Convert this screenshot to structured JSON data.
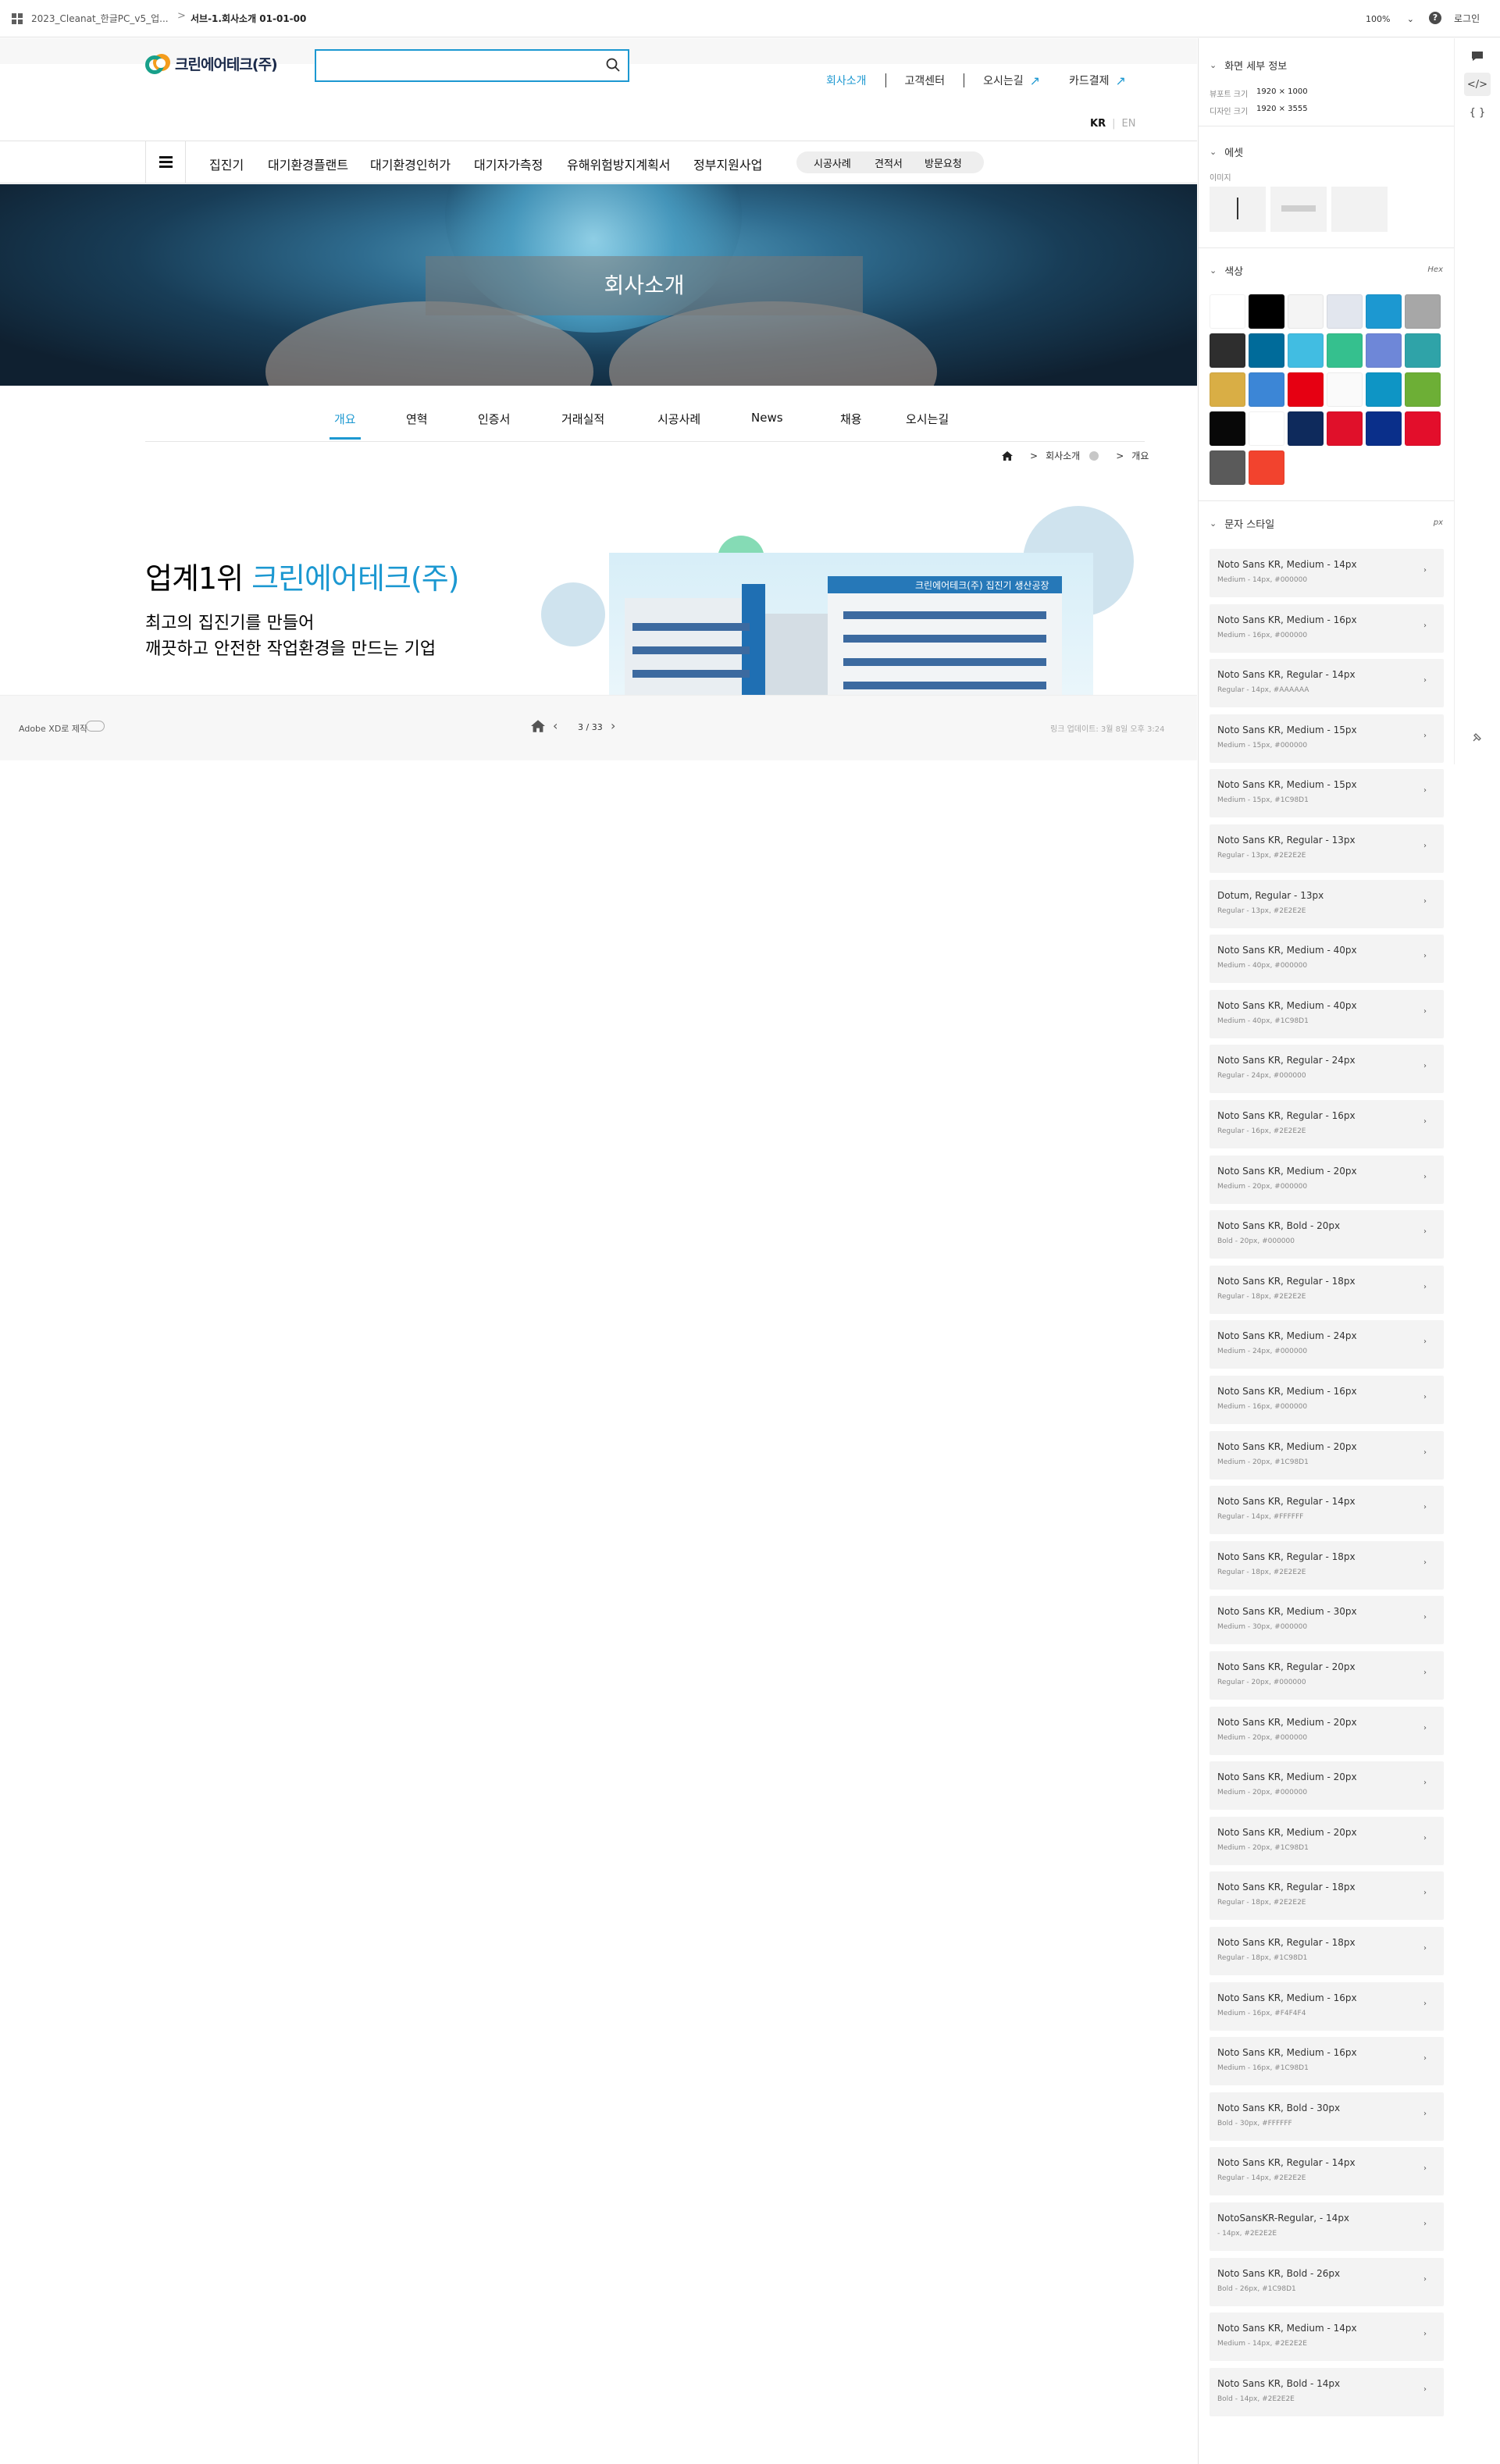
{
  "topbar": {
    "project": "2023_Cleanat_한글PC_v5_업...",
    "separator": ">",
    "artboard": "서브-1.회사소개 01-01-00",
    "zoom": "100%",
    "zoom_caret": "⌄",
    "help_icon": "?",
    "login": "로그인"
  },
  "site": {
    "logo_text": "크린에어테크(주)",
    "search_placeholder": "",
    "util_links": [
      {
        "label": "회사소개"
      },
      {
        "label": "고객센터"
      },
      {
        "label": "오시는길",
        "arrow": "↗"
      },
      {
        "label": "카드결제",
        "arrow": "↗"
      }
    ],
    "lang": {
      "kr": "KR",
      "bar": "|",
      "en": "EN"
    },
    "gnb": [
      "집진기",
      "대기환경플랜트",
      "대기환경인허가",
      "대기자가측정",
      "유해위험방지계획서",
      "정부지원사업"
    ],
    "gnb_pill": [
      "시공사례",
      "견적서",
      "방문요청"
    ],
    "hero_title": "회사소개",
    "tabs": [
      "개요",
      "연혁",
      "인증서",
      "거래실적",
      "시공사례",
      "News",
      "채용",
      "오시는길"
    ],
    "breadcrumb": {
      "sep": ">",
      "level1": "회사소개",
      "level2": "개요"
    },
    "intro_heading_plain": "업계1위 ",
    "intro_heading_accent": "크린에어테크(주)",
    "intro_line1": "최고의 집진기를 만들어",
    "intro_line2": "깨끗하고 안전한 작업환경을 만드는 기업",
    "photo_sign": "크린에어테크(주) 집진기 생산공장"
  },
  "pager": {
    "made_with": "Adobe XD로 제작",
    "prev": "‹",
    "next": "›",
    "count": "3 / 33",
    "updated": "링크 업데이트: 3월 8일 오후 3:24"
  },
  "panel": {
    "screen_info_title": "화면 세부 정보",
    "viewport_label": "뷰포트 크기",
    "viewport_value": "1920 × 1000",
    "design_label": "디자인 크기",
    "design_value": "1920 × 3555",
    "assets_title": "에셋",
    "images_label": "이미지",
    "colors_title": "색상",
    "colors_unit": "Hex",
    "colors": [
      "#FFFFFF",
      "#000000",
      "#F4F4F4",
      "#E2E6EE",
      "#1C98D1",
      "#A7A7A7",
      "#2E2E2E",
      "#006B9A",
      "#41BDE2",
      "#35C08E",
      "#6E87D8",
      "#2FA3A8",
      "#D9AE45",
      "#3C86D6",
      "#E60012",
      "#FAFAFA",
      "#0E95C5",
      "#6DAF36",
      "#080808",
      "#FFFFFF",
      "#0E2A5C",
      "#E0102A",
      "#0A2F8A",
      "#E30E2B",
      "#5A5A5A",
      "#F2432E"
    ],
    "text_styles_title": "문자 스타일",
    "text_styles_unit": "px",
    "style_arrow": "›",
    "text_styles": [
      {
        "name": "Noto Sans KR, Medium - 14px",
        "desc": "Medium - 14px, #000000"
      },
      {
        "name": "Noto Sans KR, Medium - 16px",
        "desc": "Medium - 16px, #000000"
      },
      {
        "name": "Noto Sans KR, Regular - 14px",
        "desc": "Regular - 14px, #AAAAAA"
      },
      {
        "name": "Noto Sans KR, Medium - 15px",
        "desc": "Medium - 15px, #000000"
      },
      {
        "name": "Noto Sans KR, Medium - 15px",
        "desc": "Medium - 15px, #1C98D1"
      },
      {
        "name": "Noto Sans KR, Regular - 13px",
        "desc": "Regular - 13px, #2E2E2E"
      },
      {
        "name": "Dotum, Regular - 13px",
        "desc": "Regular - 13px, #2E2E2E"
      },
      {
        "name": "Noto Sans KR, Medium - 40px",
        "desc": "Medium - 40px, #000000"
      },
      {
        "name": "Noto Sans KR, Medium - 40px",
        "desc": "Medium - 40px, #1C98D1"
      },
      {
        "name": "Noto Sans KR, Regular - 24px",
        "desc": "Regular - 24px, #000000"
      },
      {
        "name": "Noto Sans KR, Regular - 16px",
        "desc": "Regular - 16px, #2E2E2E"
      },
      {
        "name": "Noto Sans KR, Medium - 20px",
        "desc": "Medium - 20px, #000000"
      },
      {
        "name": "Noto Sans KR, Bold - 20px",
        "desc": "Bold - 20px, #000000"
      },
      {
        "name": "Noto Sans KR, Regular - 18px",
        "desc": "Regular - 18px, #2E2E2E"
      },
      {
        "name": "Noto Sans KR, Medium - 24px",
        "desc": "Medium - 24px, #000000"
      },
      {
        "name": "Noto Sans KR, Medium - 16px",
        "desc": "Medium - 16px, #000000"
      },
      {
        "name": "Noto Sans KR, Medium - 20px",
        "desc": "Medium - 20px, #1C98D1"
      },
      {
        "name": "Noto Sans KR, Regular - 14px",
        "desc": "Regular - 14px, #FFFFFF"
      },
      {
        "name": "Noto Sans KR, Regular - 18px",
        "desc": "Regular - 18px, #2E2E2E"
      },
      {
        "name": "Noto Sans KR, Medium - 30px",
        "desc": "Medium - 30px, #000000"
      },
      {
        "name": "Noto Sans KR, Regular - 20px",
        "desc": "Regular - 20px, #000000"
      },
      {
        "name": "Noto Sans KR, Medium - 20px",
        "desc": "Medium - 20px, #000000"
      },
      {
        "name": "Noto Sans KR, Medium - 20px",
        "desc": "Medium - 20px, #000000"
      },
      {
        "name": "Noto Sans KR, Medium - 20px",
        "desc": "Medium - 20px, #1C98D1"
      },
      {
        "name": "Noto Sans KR, Regular - 18px",
        "desc": "Regular - 18px, #2E2E2E"
      },
      {
        "name": "Noto Sans KR, Regular - 18px",
        "desc": "Regular - 18px, #1C98D1"
      },
      {
        "name": "Noto Sans KR, Medium - 16px",
        "desc": "Medium - 16px, #F4F4F4"
      },
      {
        "name": "Noto Sans KR, Medium - 16px",
        "desc": "Medium - 16px, #1C98D1"
      },
      {
        "name": "Noto Sans KR, Bold - 30px",
        "desc": "Bold - 30px, #FFFFFF"
      },
      {
        "name": "Noto Sans KR, Regular - 14px",
        "desc": "Regular - 14px, #2E2E2E"
      },
      {
        "name": "NotoSansKR-Regular, - 14px",
        "desc": "- 14px, #2E2E2E"
      },
      {
        "name": "Noto Sans KR, Bold - 26px",
        "desc": "Bold - 26px, #1C98D1"
      },
      {
        "name": "Noto Sans KR, Medium - 14px",
        "desc": "Medium - 14px, #2E2E2E"
      },
      {
        "name": "Noto Sans KR, Bold - 14px",
        "desc": "Bold - 14px, #2E2E2E"
      }
    ]
  },
  "rail": {
    "comment_icon": "comment-icon",
    "code_label": "</>",
    "braces_label": "{ }"
  },
  "accent": "#1C98D1"
}
